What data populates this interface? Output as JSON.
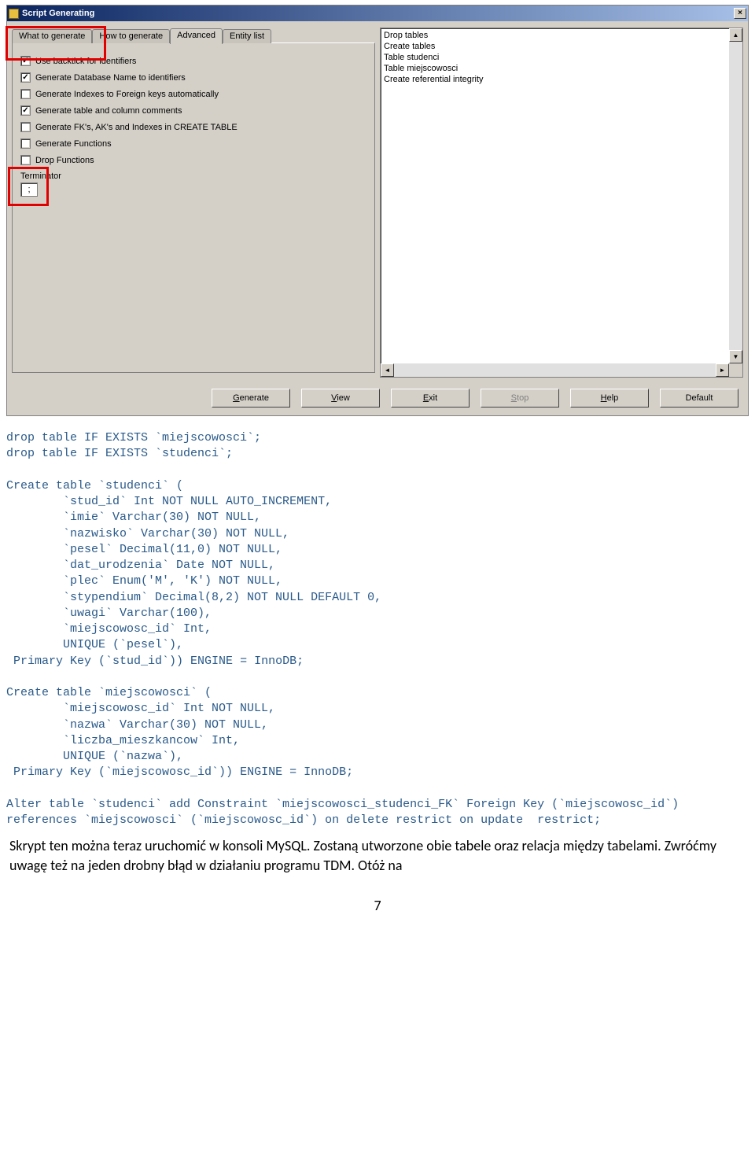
{
  "window": {
    "title": "Script Generating"
  },
  "tabs": {
    "t0": "What to generate",
    "t1": "How to generate",
    "t2": "Advanced",
    "t3": "Entity list"
  },
  "options": {
    "o0": {
      "label": "Use backtick for identifiers",
      "checked": true
    },
    "o1": {
      "label": "Generate Database Name to identifiers",
      "checked": true
    },
    "o2": {
      "label": "Generate Indexes to Foreign keys automatically",
      "checked": false
    },
    "o3": {
      "label": "Generate table and column comments",
      "checked": true
    },
    "o4": {
      "label": "Generate FK's, AK's and Indexes in CREATE TABLE",
      "checked": false
    },
    "o5": {
      "label": "Generate Functions",
      "checked": false
    },
    "o6": {
      "label": "Drop Functions",
      "checked": false
    }
  },
  "terminator": {
    "label": "Terminator",
    "value": ";"
  },
  "loglist": {
    "i0": "Drop tables",
    "i1": "Create tables",
    "i2": "Table studenci",
    "i3": "Table miejscowosci",
    "i4": "Create referential integrity"
  },
  "buttons": {
    "generate": "Generate",
    "view": "View",
    "exit": "Exit",
    "stop": "Stop",
    "help": "Help",
    "default": "Default"
  },
  "sql": {
    "l0": "drop table IF EXISTS `miejscowosci`;",
    "l1": "drop table IF EXISTS `studenci`;",
    "l2": "",
    "l3": "Create table `studenci` (",
    "l4": "\t`stud_id` Int NOT NULL AUTO_INCREMENT,",
    "l5": "\t`imie` Varchar(30) NOT NULL,",
    "l6": "\t`nazwisko` Varchar(30) NOT NULL,",
    "l7": "\t`pesel` Decimal(11,0) NOT NULL,",
    "l8": "\t`dat_urodzenia` Date NOT NULL,",
    "l9": "\t`plec` Enum('M', 'K') NOT NULL,",
    "l10": "\t`stypendium` Decimal(8,2) NOT NULL DEFAULT 0,",
    "l11": "\t`uwagi` Varchar(100),",
    "l12": "\t`miejscowosc_id` Int,",
    "l13": "\tUNIQUE (`pesel`),",
    "l14": " Primary Key (`stud_id`)) ENGINE = InnoDB;",
    "l15": "",
    "l16": "Create table `miejscowosci` (",
    "l17": "\t`miejscowosc_id` Int NOT NULL,",
    "l18": "\t`nazwa` Varchar(30) NOT NULL,",
    "l19": "\t`liczba_mieszkancow` Int,",
    "l20": "\tUNIQUE (`nazwa`),",
    "l21": " Primary Key (`miejscowosc_id`)) ENGINE = InnoDB;",
    "l22": "",
    "l23": "Alter table `studenci` add Constraint `miejscowosci_studenci_FK` Foreign Key (`miejscowosc_id`) references `miejscowosci` (`miejscowosc_id`) on delete restrict on update  restrict;"
  },
  "paragraph": "Skrypt ten można teraz uruchomić w konsoli MySQL. Zostaną utworzone obie tabele oraz relacja między tabelami. Zwróćmy uwagę też na jeden drobny błąd w działaniu programu TDM. Otóż na",
  "pagenum": "7"
}
